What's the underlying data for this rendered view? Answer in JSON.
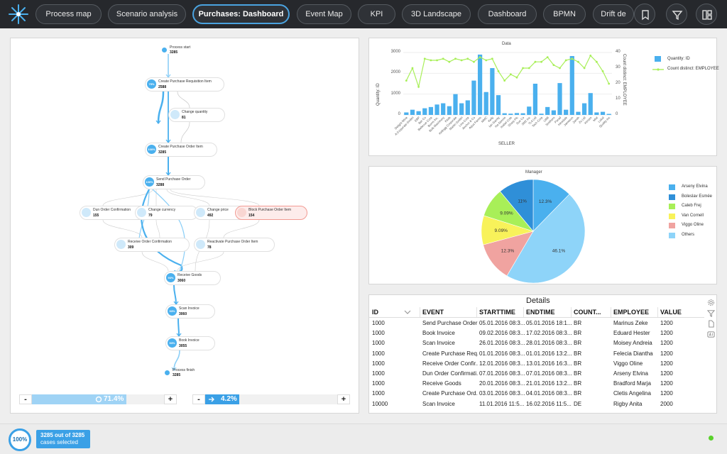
{
  "nav": {
    "tabs": [
      {
        "label": "Process map"
      },
      {
        "label": "Scenario analysis"
      },
      {
        "label": "Purchases: Dashboard"
      },
      {
        "label": "Event Map"
      },
      {
        "label": "KPI"
      },
      {
        "label": "3D Landscape"
      },
      {
        "label": "Dashboard"
      },
      {
        "label": "BPMN"
      },
      {
        "label": "Drift de"
      }
    ],
    "active_index": 2,
    "right_icons": [
      "bookmark-icon",
      "filter-icon",
      "layout-icon"
    ]
  },
  "process_map": {
    "nodes": [
      {
        "name": "Process start",
        "count": "3285"
      },
      {
        "name": "Create Purchase Requisition Item",
        "count": "2588",
        "pct": "79%"
      },
      {
        "name": "Change quantity",
        "count": "81"
      },
      {
        "name": "Create Purchase Order Item",
        "count": "3285",
        "pct": "100%"
      },
      {
        "name": "Send Purchase Order",
        "count": "3288",
        "pct": "100%"
      },
      {
        "name": "Dun Order Confirmation",
        "count": "155"
      },
      {
        "name": "Change currency",
        "count": "79"
      },
      {
        "name": "Change price",
        "count": "492"
      },
      {
        "name": "Block Purchase Order Item",
        "count": "154"
      },
      {
        "name": "Receive Order Confirmation",
        "count": "309"
      },
      {
        "name": "Reactivate Purchase Order Item",
        "count": "78"
      },
      {
        "name": "Receive Goods",
        "count": "3060",
        "pct": "93%"
      },
      {
        "name": "Scan Invoice",
        "count": "3060",
        "pct": "93%"
      },
      {
        "name": "Book Invoice",
        "count": "3055",
        "pct": "93%"
      },
      {
        "name": "Process finish",
        "count": "3285"
      }
    ],
    "slider_left": {
      "minus": "-",
      "plus": "+",
      "value": "71.4%",
      "fraction": 0.714
    },
    "slider_right": {
      "minus": "-",
      "plus": "+",
      "value": "4.2%",
      "fraction": 0.042
    }
  },
  "chart_data": [
    {
      "type": "bar",
      "title": "Data",
      "xlabel": "SELLER",
      "ylabel": "Quantity: ID",
      "y2label": "Count distinct: EMPLOYEE",
      "ylim": [
        0,
        3000
      ],
      "y2lim": [
        0,
        40
      ],
      "yticks": [
        "0",
        "1000",
        "2000",
        "3000"
      ],
      "y2ticks": [
        "0",
        "10",
        "20",
        "30",
        "40"
      ],
      "categories": [
        "Delight Wine",
        "A Corporate GmbH",
        "EBP",
        "Ber Co",
        "Bellevue Corp",
        "Burns Inc.",
        "Bulk Machinery",
        "Kitab",
        "Kellogg Corporate",
        "Martin GmbH",
        "Lina Corp",
        "Anchor & Co",
        "Aqua Farms",
        "MMC",
        "Kelly",
        "Ian Garrity",
        "Isa Dennis",
        "Isabel Cole",
        "Sharp Plc",
        "Sue Co",
        "SM2 Inc",
        "TL4 Ltd",
        "Tech Corp",
        "UAB",
        "Smithers",
        "Parad",
        "Hinsdale",
        "Jameson",
        "Zenith",
        "Zo Ltd",
        "Xerxes",
        "Mist",
        "Lokal",
        "Quality Inc"
      ],
      "series": [
        {
          "name": "Quantity: ID",
          "type": "bar",
          "color": "#4ab0ee",
          "values": [
            120,
            250,
            180,
            320,
            380,
            500,
            560,
            420,
            1000,
            560,
            700,
            1650,
            2900,
            1100,
            2250,
            950,
            80,
            60,
            90,
            80,
            400,
            1500,
            60,
            380,
            220,
            1530,
            250,
            2830,
            150,
            560,
            1050,
            120,
            150,
            50
          ]
        },
        {
          "name": "Count distinct: EMPLOYEE",
          "type": "line",
          "color": "#a8ef58",
          "values": [
            22,
            30,
            18,
            36,
            35,
            35,
            36,
            34,
            36,
            35,
            36,
            34,
            37,
            35,
            36,
            28,
            22,
            26,
            24,
            30,
            30,
            34,
            34,
            37,
            32,
            30,
            35,
            36,
            34,
            30,
            38,
            34,
            28,
            20
          ]
        }
      ],
      "legend_position": "right"
    },
    {
      "type": "pie",
      "title": "Manager",
      "slices": [
        {
          "label": "Arseny Elvina",
          "value": 12.3,
          "text": "12.3%",
          "color": "#4ab0ee"
        },
        {
          "label": "Others",
          "value": 46.1,
          "text": "46.1%",
          "color": "#8ed4f9"
        },
        {
          "label": "Viggo Oline",
          "value": 12.3,
          "text": "12.3%",
          "color": "#f0a3a0"
        },
        {
          "label": "Van Cornell",
          "value": 9.09,
          "text": "9.09%",
          "color": "#f8f25a"
        },
        {
          "label": "Caleb Frej",
          "value": 9.09,
          "text": "9.09%",
          "color": "#a8ef58"
        },
        {
          "label": "Boleslav Esmée",
          "value": 11,
          "text": "11%",
          "color": "#2f8fd8"
        }
      ],
      "legend": [
        {
          "label": "Arseny Elvina",
          "color": "#4ab0ee"
        },
        {
          "label": "Boleslav Esmée",
          "color": "#2f8fd8"
        },
        {
          "label": "Caleb Frej",
          "color": "#a8ef58"
        },
        {
          "label": "Van Cornell",
          "color": "#f8f25a"
        },
        {
          "label": "Viggo Oline",
          "color": "#f0a3a0"
        },
        {
          "label": "Others",
          "color": "#8ed4f9"
        }
      ],
      "legend_position": "right"
    }
  ],
  "details": {
    "title": "Details",
    "columns": [
      "ID",
      "EVENT",
      "STARTTIME",
      "ENDTIME",
      "COUNT...",
      "EMPLOYEE",
      "VALUE"
    ],
    "rows": [
      [
        "1000",
        "Send Purchase Order",
        "05.01.2016 08:3...",
        "05.01.2016 18:1...",
        "BR",
        "Marinus Zeke",
        "1200"
      ],
      [
        "1000",
        "Book Invoice",
        "09.02.2016 08:3...",
        "17.02.2016 08:3...",
        "BR",
        "Eduard Hester",
        "1200"
      ],
      [
        "1000",
        "Scan Invoice",
        "26.01.2016 08:3...",
        "28.01.2016 08:3...",
        "BR",
        "Moisey Andreia",
        "1200"
      ],
      [
        "1000",
        "Create Purchase Req...",
        "01.01.2016 08:3...",
        "01.01.2016 13:2...",
        "BR",
        "Felecia Diantha",
        "1200"
      ],
      [
        "1000",
        "Receive Order Confir...",
        "12.01.2016 08:3...",
        "13.01.2016 16:3...",
        "BR",
        "Viggo Oline",
        "1200"
      ],
      [
        "1000",
        "Dun Order Confirmati...",
        "07.01.2016 08:3...",
        "07.01.2016 08:3...",
        "BR",
        "Arseny Elvina",
        "1200"
      ],
      [
        "1000",
        "Receive Goods",
        "20.01.2016 08:3...",
        "21.01.2016 13:2...",
        "BR",
        "Bradford Marja",
        "1200"
      ],
      [
        "1000",
        "Create Purchase Ord...",
        "03.01.2016 08:3...",
        "04.01.2016 08:3...",
        "BR",
        "Cletis Angelina",
        "1200"
      ],
      [
        "10000",
        "Scan Invoice",
        "11.01.2016 11:5...",
        "16.02.2016 11:5...",
        "DE",
        "Rigby Anita",
        "2000"
      ]
    ],
    "side_icons": [
      "settings-icon",
      "filter-icon",
      "document-icon",
      "ai-icon"
    ]
  },
  "footer": {
    "percent": "100%",
    "cases_line1": "3285 out of 3285",
    "cases_line2": "cases selected",
    "status_color": "#5ad12c"
  }
}
